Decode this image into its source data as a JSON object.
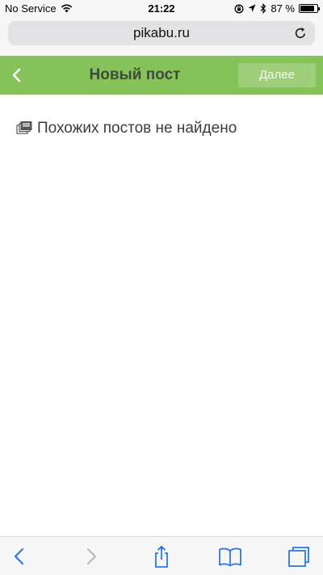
{
  "status_bar": {
    "carrier": "No Service",
    "time": "21:22",
    "battery_label": "87 %",
    "battery_level": 0.87
  },
  "browser": {
    "url": "pikabu.ru"
  },
  "header": {
    "title": "Новый пост",
    "next_label": "Далее"
  },
  "content": {
    "empty_message": "Похожих постов не найдено"
  },
  "colors": {
    "header_green": "#86c25a",
    "next_button": "#a0cf7c",
    "toolbar_icon_blue": "#2a78e4"
  },
  "icons": {
    "status": [
      "wifi-icon",
      "orientation-lock-icon",
      "location-icon",
      "bluetooth-icon",
      "battery-icon"
    ],
    "toolbar": [
      "back-icon",
      "forward-icon",
      "share-icon",
      "bookmarks-icon",
      "tabs-icon"
    ]
  }
}
